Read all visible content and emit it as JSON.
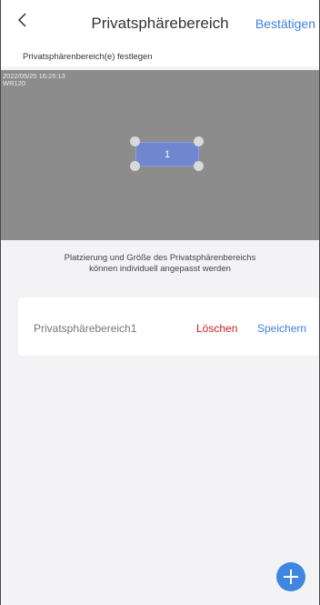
{
  "header": {
    "title": "Privatsphärebereich",
    "confirm_label": "Bestätigen",
    "back_icon": "chevron-left-icon"
  },
  "subheader": {
    "label": "Privatsphärenbereich(e) festlegen"
  },
  "video": {
    "timestamp": "2022/05/25 16:25:13",
    "camera_name": "WR120",
    "zone_label": "1"
  },
  "hint": {
    "line1": "Platzierung und Größe des Privatsphärenbereichs",
    "line2": "können individuell angepasst werden"
  },
  "zone_item": {
    "name": "Privatsphärebereich1",
    "delete_label": "Löschen",
    "save_label": "Speichern"
  },
  "add_button": {
    "icon": "plus-icon"
  },
  "colors": {
    "accent": "#3f7fe0",
    "danger": "#cf1d1d",
    "zone": "#6f86d0"
  }
}
